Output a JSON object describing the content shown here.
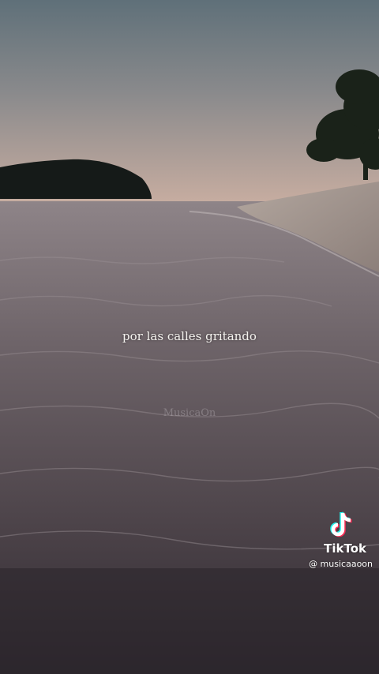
{
  "overlay": {
    "caption": "por las calles gritando",
    "watermark": "MusicaOn"
  },
  "tiktok": {
    "icon": "tiktok-logo-icon",
    "brand": "TikTok",
    "username": "@ musicaaoon"
  }
}
